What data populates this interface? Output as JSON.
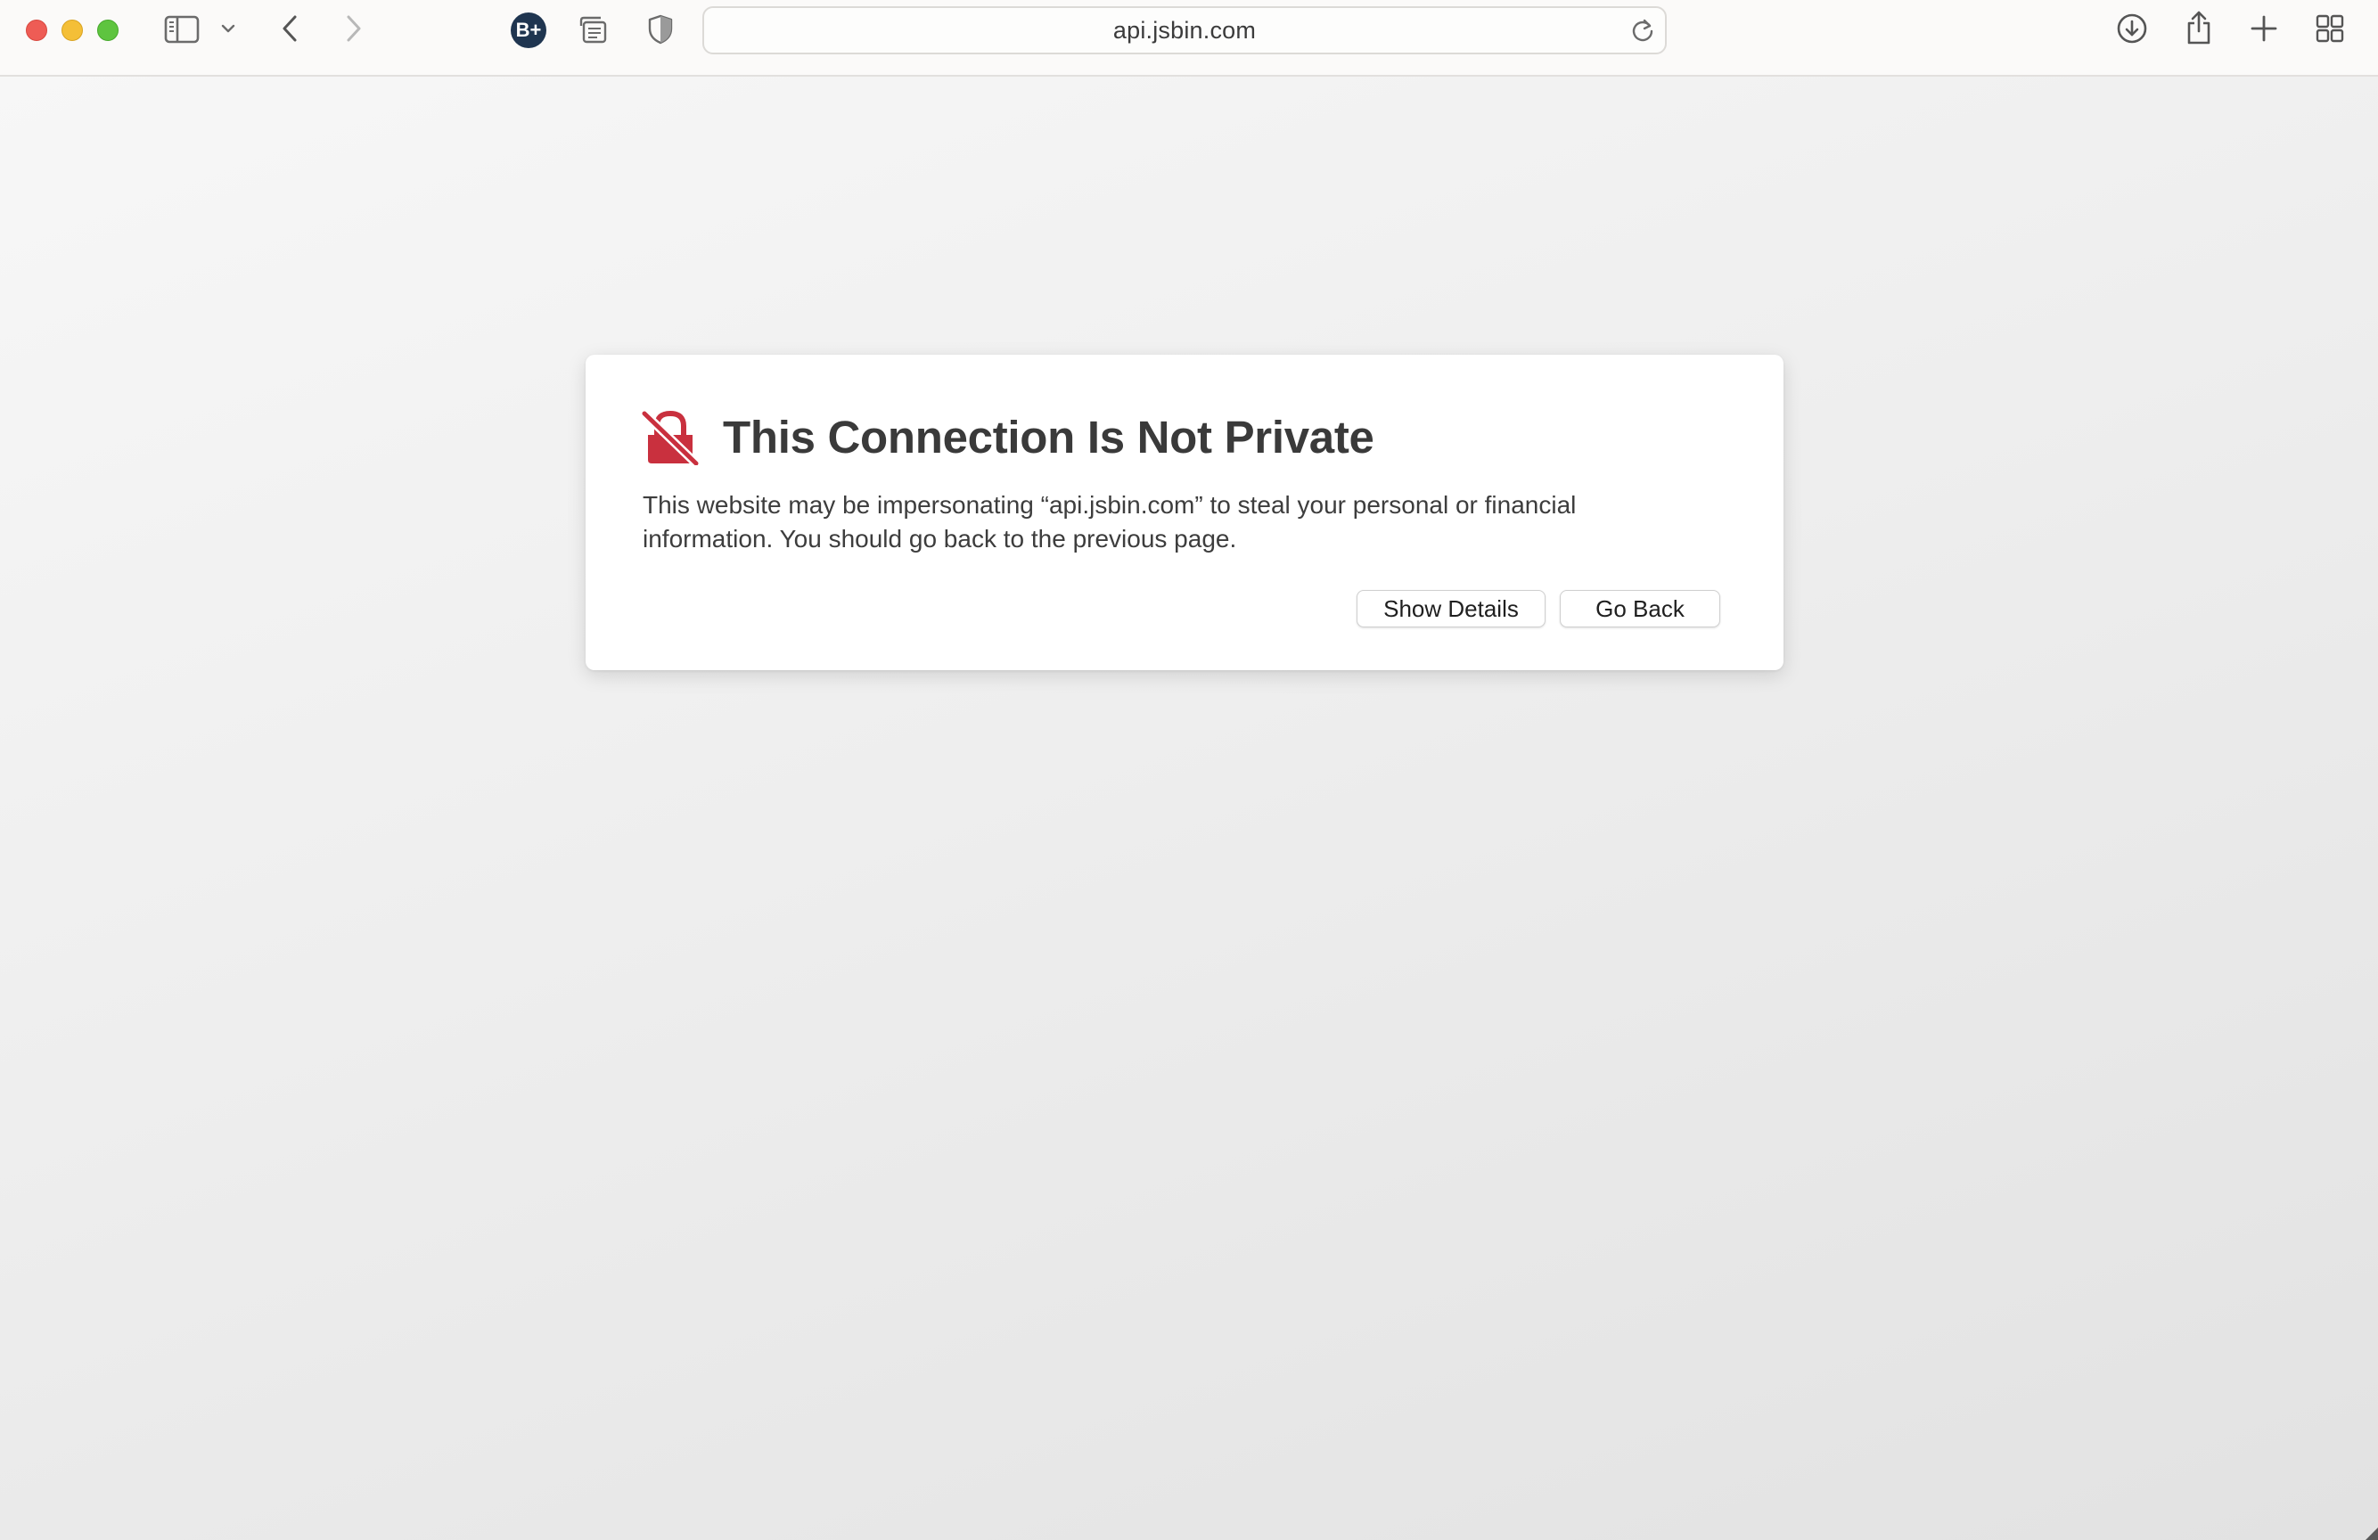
{
  "window": {
    "address": "api.jsbin.com"
  },
  "toolbar": {
    "icons": [
      "close-button",
      "minimize-button",
      "zoom-button",
      "sidebar-icon",
      "chevron-down-icon",
      "back-icon",
      "forward-icon",
      "bplus-extension-icon",
      "reader-icon",
      "privacy-shield-icon",
      "reload-icon",
      "download-icon",
      "share-icon",
      "new-tab-icon",
      "tab-overview-icon"
    ],
    "extension_badge": "B+"
  },
  "warning": {
    "title": "This Connection Is Not Private",
    "body": "This website may be impersonating “api.jsbin.com” to steal your personal or financial information. You should go back to the previous page.",
    "show_details_label": "Show Details",
    "go_back_label": "Go Back",
    "icon": "broken-lock-warning-icon",
    "accent_color": "#c9303e"
  },
  "colors": {
    "close": "#ee5c55",
    "minimize": "#f4bf37",
    "zoom": "#5ec43f",
    "toolbar_bg": "#fbfaf9",
    "page_bg": "#eeeeee"
  }
}
